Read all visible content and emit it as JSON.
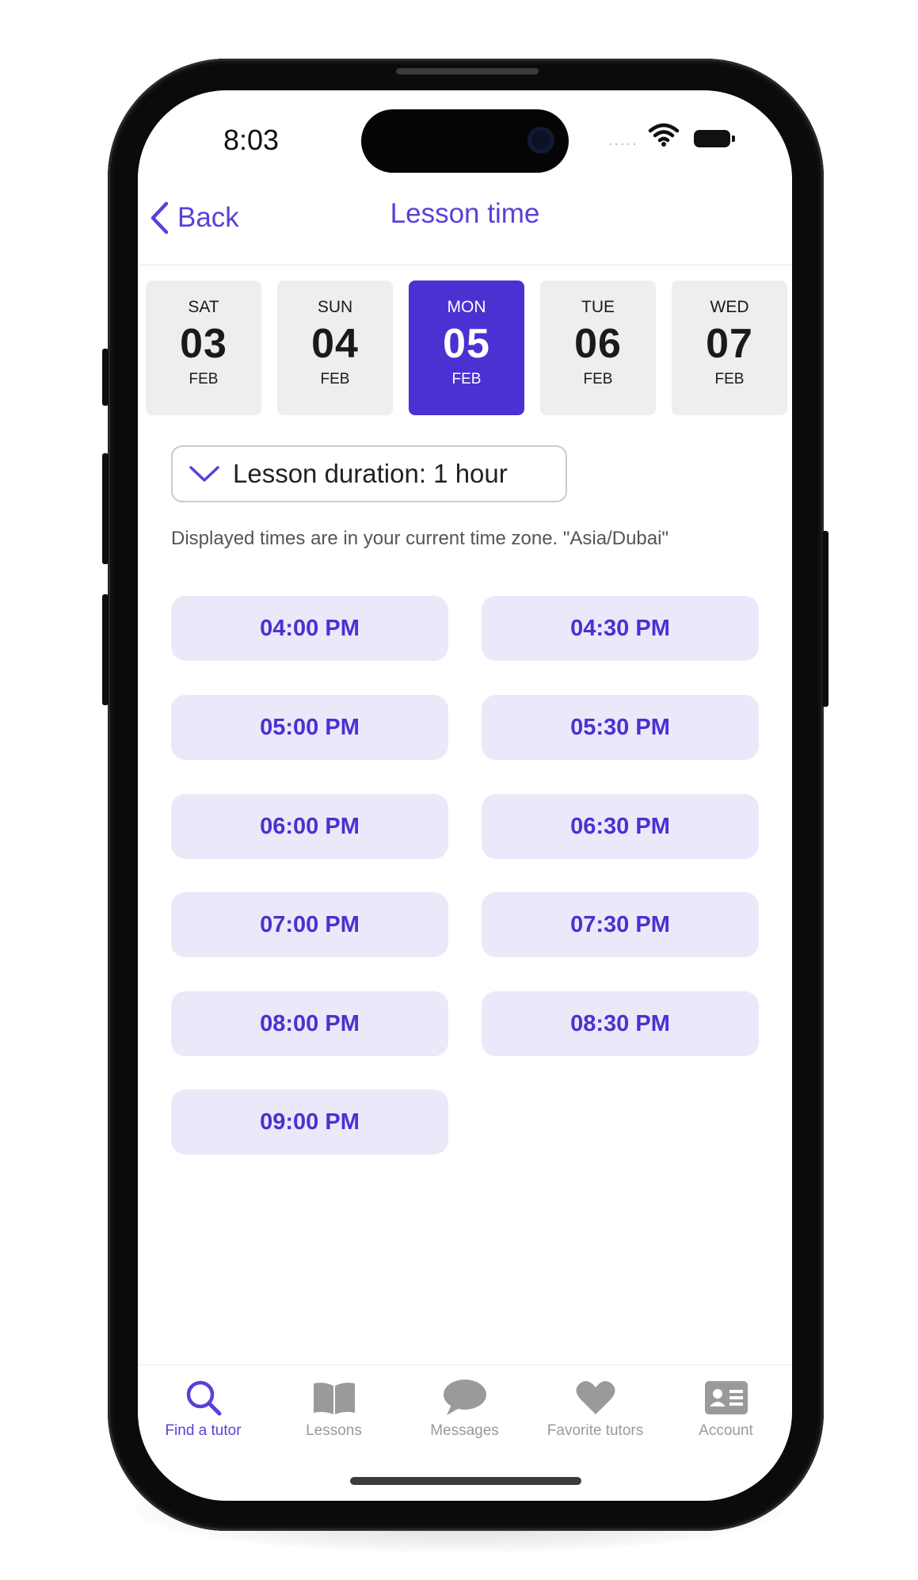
{
  "status_bar": {
    "time": "8:03",
    "signal_dots": "....."
  },
  "nav": {
    "back_label": "Back",
    "title": "Lesson time"
  },
  "dates": [
    {
      "day": "SAT",
      "num": "03",
      "month": "FEB",
      "selected": false
    },
    {
      "day": "SUN",
      "num": "04",
      "month": "FEB",
      "selected": false
    },
    {
      "day": "MON",
      "num": "05",
      "month": "FEB",
      "selected": true
    },
    {
      "day": "TUE",
      "num": "06",
      "month": "FEB",
      "selected": false
    },
    {
      "day": "WED",
      "num": "07",
      "month": "FEB",
      "selected": false
    }
  ],
  "duration": {
    "label": "Lesson duration:  1 hour"
  },
  "timezone_note": "Displayed times are in your current time zone. \"Asia/Dubai\"",
  "slots": [
    "04:00 PM",
    "04:30 PM",
    "05:00 PM",
    "05:30 PM",
    "06:00 PM",
    "06:30 PM",
    "07:00 PM",
    "07:30 PM",
    "08:00 PM",
    "08:30 PM",
    "09:00 PM"
  ],
  "tabs": [
    {
      "label": "Find a tutor",
      "icon": "search-icon",
      "active": true
    },
    {
      "label": "Lessons",
      "icon": "book-icon",
      "active": false
    },
    {
      "label": "Messages",
      "icon": "chat-bubble-icon",
      "active": false
    },
    {
      "label": "Favorite tutors",
      "icon": "heart-icon",
      "active": false
    },
    {
      "label": "Account",
      "icon": "id-card-icon",
      "active": false
    }
  ],
  "colors": {
    "accent": "#4a31d1",
    "slot_bg": "#ebe8fa",
    "inactive_tab": "#9a9a9a"
  }
}
